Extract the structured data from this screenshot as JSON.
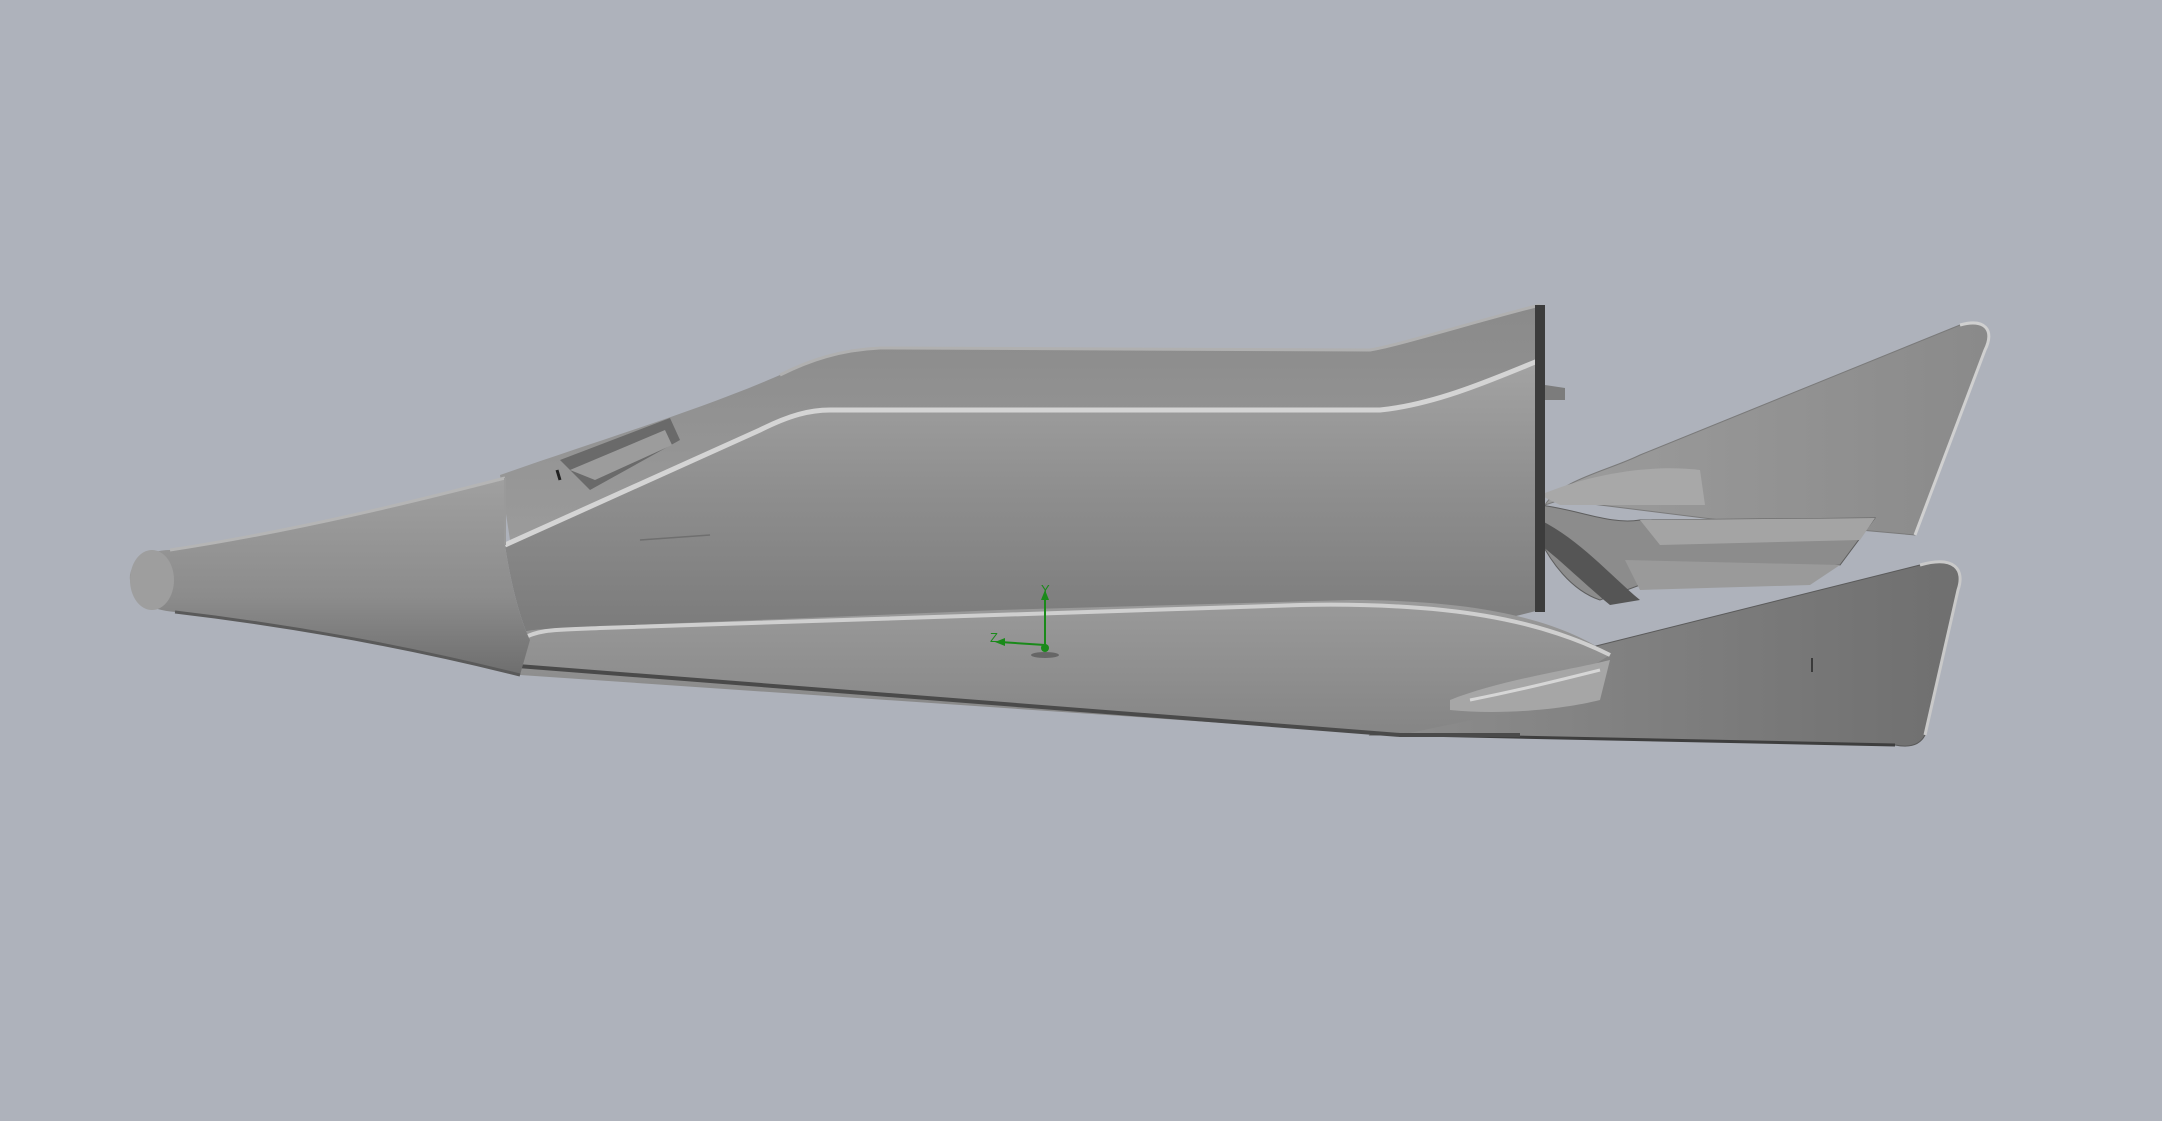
{
  "viewport": {
    "background": "#aeb2bb",
    "model_fill": "#8f8f8f",
    "model_highlight": "#c9c9c9",
    "model_shadow": "#5a5a5a"
  },
  "triad": {
    "y_label": "Y",
    "z_label": "Z",
    "color": "#1a8a1a",
    "icon": "coordinate-triad-icon"
  }
}
